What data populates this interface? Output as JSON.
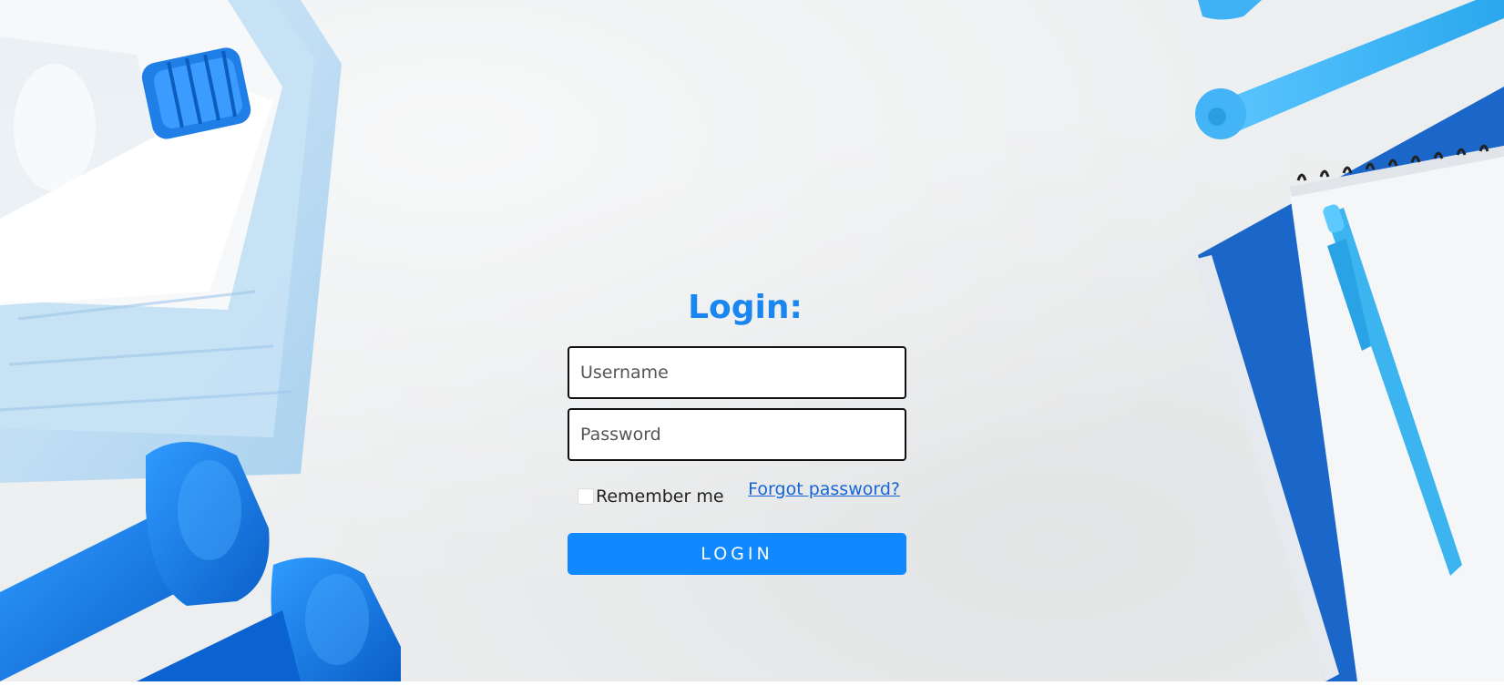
{
  "login": {
    "title": "Login:",
    "username_placeholder": "Username",
    "password_placeholder": "Password",
    "remember_label": "Remember me",
    "forgot_label": "Forgot password?",
    "button_label": "LOGIN"
  },
  "theme": {
    "accent": "#1088ff",
    "title_color": "#1a87f0",
    "link_color": "#1565d8"
  },
  "background_items": [
    "water-bottle",
    "towel",
    "dumbbells",
    "jump-rope-handles",
    "notebook",
    "pen"
  ]
}
